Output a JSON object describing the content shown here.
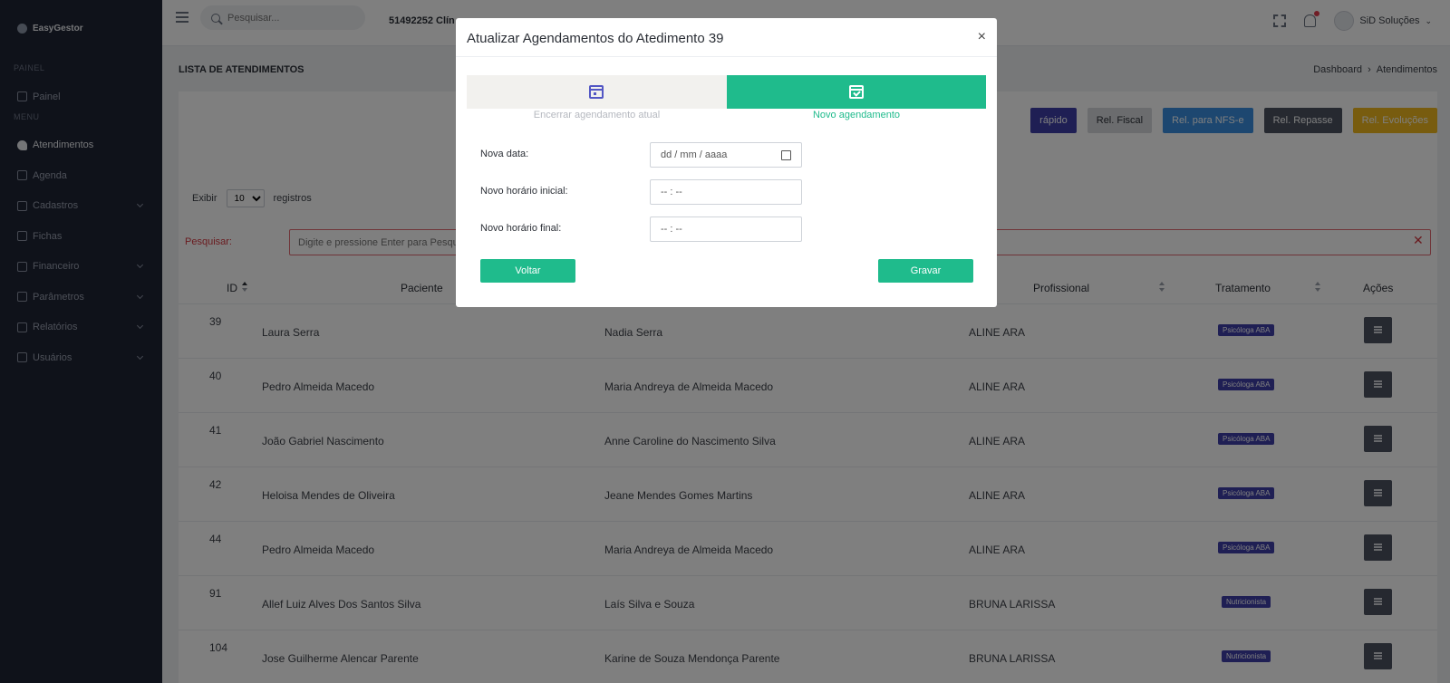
{
  "brand": {
    "name": "EasyGestor"
  },
  "sidebar": {
    "section_painel": "PAINEL",
    "section_menu": "MENU",
    "items": [
      {
        "label": "Painel",
        "icon": "dashboard-icon",
        "has_chevron": false
      },
      {
        "label": "Atendimentos",
        "icon": "heart-icon",
        "has_chevron": false
      },
      {
        "label": "Agenda",
        "icon": "calendar-icon",
        "has_chevron": false
      },
      {
        "label": "Cadastros",
        "icon": "archive-icon",
        "has_chevron": true
      },
      {
        "label": "Fichas",
        "icon": "book-icon",
        "has_chevron": false
      },
      {
        "label": "Financeiro",
        "icon": "finance-icon",
        "has_chevron": true
      },
      {
        "label": "Parâmetros",
        "icon": "globe-icon",
        "has_chevron": true
      },
      {
        "label": "Relatórios",
        "icon": "report-icon",
        "has_chevron": true
      },
      {
        "label": "Usuários",
        "icon": "user-circle-icon",
        "has_chevron": true
      }
    ],
    "active": "Atendimentos"
  },
  "topbar": {
    "search_placeholder": "Pesquisar...",
    "clinic": "51492252 Clín",
    "user": "SiD Soluções"
  },
  "page": {
    "title": "LISTA DE ATENDIMENTOS",
    "breadcrumb": [
      "Dashboard",
      "›",
      "Atendimentos"
    ]
  },
  "report_buttons": [
    {
      "label": "rápido",
      "color": "#3e3fa8"
    },
    {
      "label": "Rel. Fiscal",
      "color": "#d7d9dd"
    },
    {
      "label": "Rel. para NFS-e",
      "color": "#3a8fe0"
    },
    {
      "label": "Rel. Repasse",
      "color": "#4c5260"
    },
    {
      "label": "Rel. Evoluções",
      "color": "#f0b81f"
    }
  ],
  "list_controls": {
    "exibir_label": "Exibir",
    "page_size": "10",
    "registros_label": "registros",
    "pesquisar_label": "Pesquisar:",
    "pesquisar_placeholder": "Digite e pressione Enter para Pesqui",
    "clear_symbol": "✕"
  },
  "table": {
    "headers": {
      "id": "ID",
      "paciente": "Paciente",
      "profissional": "Profissional",
      "tratamento": "Tratamento",
      "acoes": "Ações"
    },
    "rows": [
      {
        "id": "39",
        "paciente": "Laura Serra",
        "responsavel": "Nadia Serra",
        "profissional": "ALINE ARA",
        "tratamento": "Psicóloga ABA"
      },
      {
        "id": "40",
        "paciente": "Pedro Almeida Macedo",
        "responsavel": "Maria Andreya de Almeida Macedo",
        "profissional": "ALINE ARA",
        "tratamento": "Psicóloga ABA"
      },
      {
        "id": "41",
        "paciente": "João Gabriel Nascimento",
        "responsavel": "Anne Caroline do Nascimento Silva",
        "profissional": "ALINE ARA",
        "tratamento": "Psicóloga ABA"
      },
      {
        "id": "42",
        "paciente": "Heloisa Mendes de Oliveira",
        "responsavel": "Jeane Mendes Gomes Martins",
        "profissional": "ALINE ARA",
        "tratamento": "Psicóloga ABA"
      },
      {
        "id": "44",
        "paciente": "Pedro Almeida Macedo",
        "responsavel": "Maria Andreya de Almeida Macedo",
        "profissional": "ALINE ARA",
        "tratamento": "Psicóloga ABA"
      },
      {
        "id": "91",
        "paciente": "Allef Luiz Alves Dos Santos Silva",
        "responsavel": "Laís Silva e Souza",
        "profissional": "BRUNA LARISSA",
        "tratamento": "Nutricionista"
      },
      {
        "id": "104",
        "paciente": "Jose Guilherme Alencar Parente",
        "responsavel": "Karine de Souza Mendonça Parente",
        "profissional": "BRUNA LARISSA",
        "tratamento": "Nutricionista"
      }
    ]
  },
  "modal": {
    "title": "Atualizar Agendamentos do Atedimento 39",
    "close": "×",
    "step1_label": "Encerrar agendamento atual",
    "step2_label": "Novo agendamento",
    "fields": [
      {
        "label": "Nova data:",
        "value": "dd / mm / aaaa"
      },
      {
        "label": "Novo horário inicial:",
        "value": "-- : --"
      },
      {
        "label": "Novo horário final:",
        "value": "-- : --"
      }
    ],
    "back_button": "Voltar",
    "save_button": "Gravar",
    "accent_color": "#1fbb8c"
  }
}
